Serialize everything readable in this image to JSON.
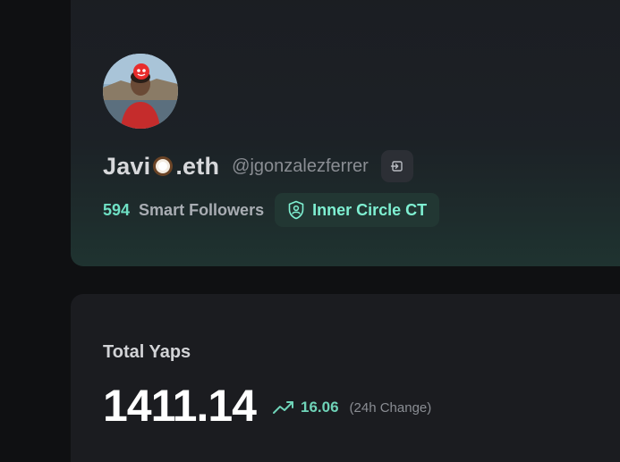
{
  "profile": {
    "display_name_prefix": "Javi",
    "display_name_emoji": "coconut-emoji",
    "display_name_suffix": ".eth",
    "handle": "@jgonzalezferrer",
    "smart_followers_count": "594",
    "smart_followers_label": "Smart Followers",
    "badge_label": "Inner Circle CT",
    "badge_icon": "shield-user-icon",
    "login_icon": "sign-in-icon"
  },
  "yaps": {
    "title": "Total Yaps",
    "total": "1411.14",
    "change_value": "16.06",
    "change_label": "(24h Change)",
    "trend_icon": "trending-up-icon"
  },
  "colors": {
    "accent": "#6fe0c4",
    "badge_bg": "#223733",
    "card_bg": "#1b1c20"
  }
}
